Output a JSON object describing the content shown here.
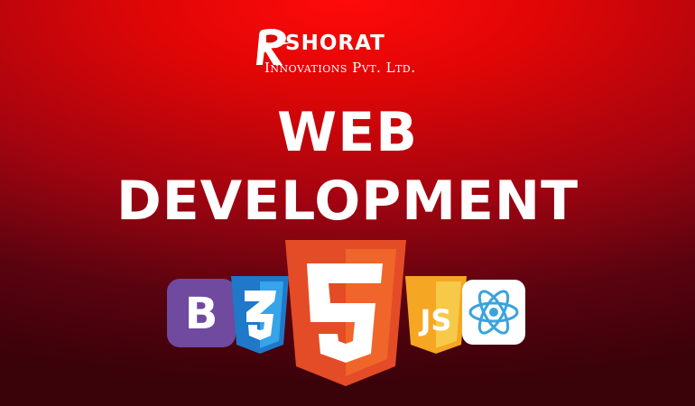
{
  "brand": {
    "name": "SHORAT",
    "subtitle": "Innovations Pvt. Ltd.",
    "logo_icon": "r-swoosh-logo-icon"
  },
  "headline": {
    "line1": "WEB",
    "line2": "DEVELOPMENT"
  },
  "tech_logos": [
    {
      "name": "bootstrap-logo-icon",
      "glyph": "B",
      "color": "#6f4a9e"
    },
    {
      "name": "css3-logo-icon",
      "glyph": "3",
      "color": "#1f78c8"
    },
    {
      "name": "html5-logo-icon",
      "glyph": "5",
      "color": "#e34c26"
    },
    {
      "name": "javascript-logo-icon",
      "glyph": "JS",
      "color": "#f5a623"
    },
    {
      "name": "react-logo-icon",
      "color": "#3aa3dc"
    }
  ],
  "colors": {
    "background_top": "#ff0a0a",
    "background_bottom": "#3a0209",
    "text": "#ffffff"
  }
}
